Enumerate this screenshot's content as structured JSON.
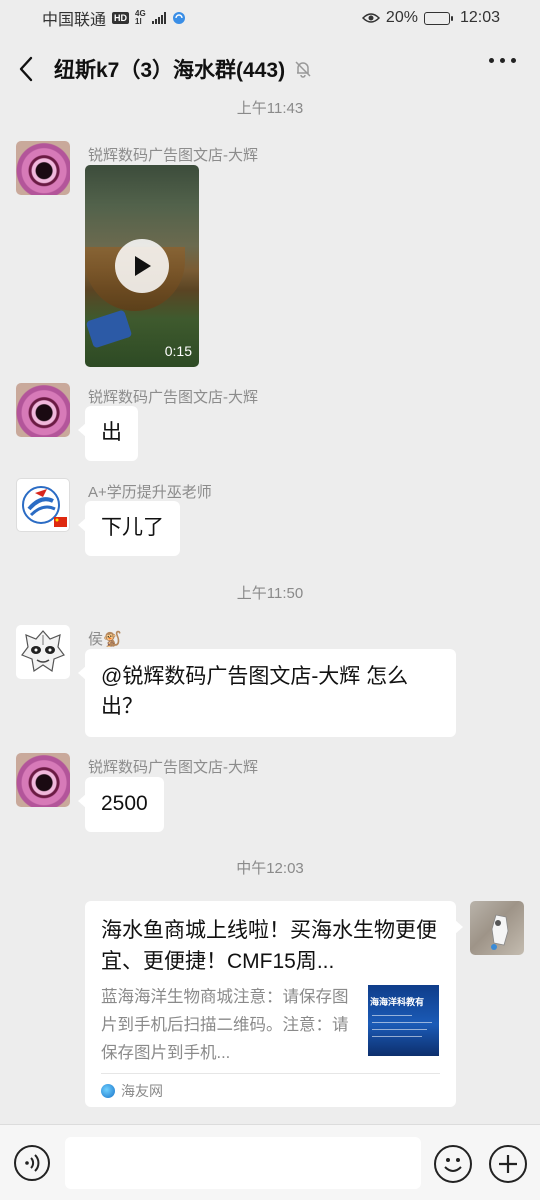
{
  "status_bar": {
    "carrier": "中国联通",
    "hd": "HD",
    "network_top": "4G",
    "network_bottom": "1l",
    "battery": "20%",
    "battery_level": 0.2,
    "time": "12:03"
  },
  "header": {
    "title": "纽斯k7（3）海水群(443)"
  },
  "timestamps": [
    "上午11:43",
    "上午11:50",
    "中午12:03"
  ],
  "messages": [
    {
      "sender": "锐辉数码广告图文店-大辉",
      "type": "video",
      "duration": "0:15"
    },
    {
      "sender": "锐辉数码广告图文店-大辉",
      "type": "text",
      "text": "出"
    },
    {
      "sender": "A+学历提升巫老师",
      "type": "text",
      "text": "下儿了"
    },
    {
      "sender": "侯🐒",
      "type": "text",
      "text": "@锐辉数码广告图文店-大辉  怎么出？"
    },
    {
      "sender": "锐辉数码广告图文店-大辉",
      "type": "text",
      "text": "2500"
    },
    {
      "sender": "me",
      "type": "link_card",
      "title": "海水鱼商城上线啦！买海水生物更便宜、更便捷！CMF15周...",
      "description": "蓝海海洋生物商城注意：请保存图片到手机后扫描二维码。注意：请保存图片到手机...",
      "thumbnail_text": "海海洋科教有",
      "source": "海友网"
    }
  ],
  "input_bar": {
    "placeholder": ""
  }
}
